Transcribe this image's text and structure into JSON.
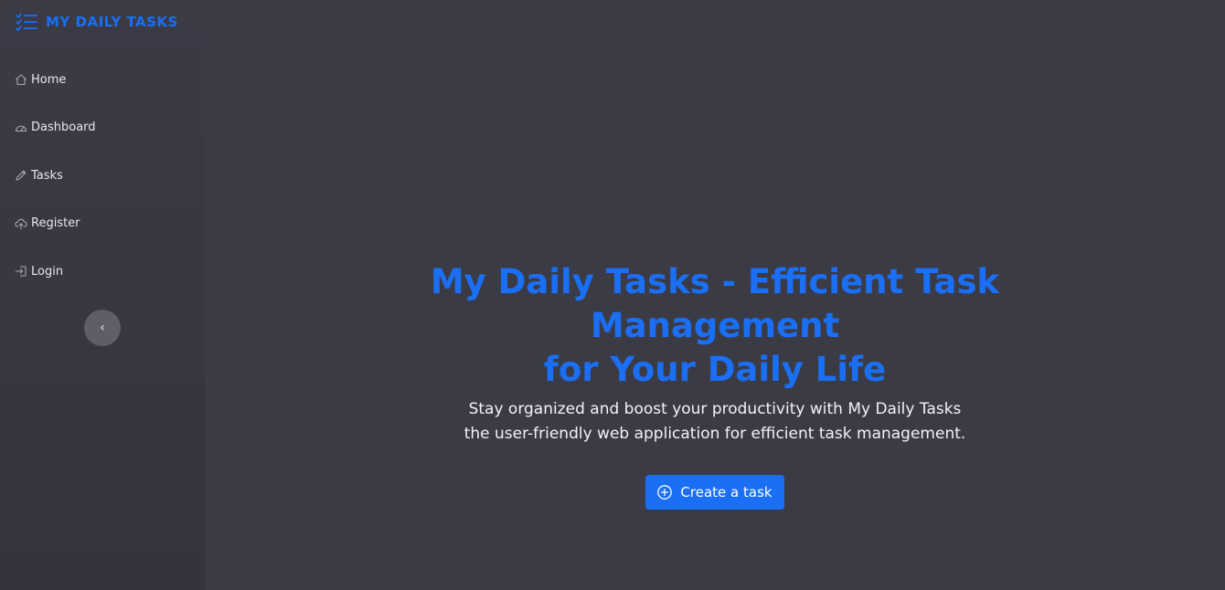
{
  "brand": {
    "title": "MY DAILY TASKS",
    "icon": "checklist-icon",
    "color": "#1a6ff5"
  },
  "sidebar": {
    "items": [
      {
        "label": "Home",
        "icon": "home-icon"
      },
      {
        "label": "Dashboard",
        "icon": "speedometer-icon"
      },
      {
        "label": "Tasks",
        "icon": "pencil-icon"
      },
      {
        "label": "Register",
        "icon": "cloud-upload-icon"
      },
      {
        "label": "Login",
        "icon": "login-icon"
      }
    ],
    "collapse_glyph": "‹"
  },
  "hero": {
    "title_lines": [
      "My Daily Tasks - Efficient Task",
      "Management",
      "for Your Daily Life"
    ],
    "subtitle_lines": [
      "Stay organized and boost your productivity with My Daily Tasks",
      "the user-friendly web application for efficient task management."
    ],
    "cta_label": "Create a task",
    "cta_icon": "plus-circle-icon"
  },
  "colors": {
    "accent": "#1a6ff5",
    "background": "#3b3b46",
    "text": "#f2f2f6"
  }
}
